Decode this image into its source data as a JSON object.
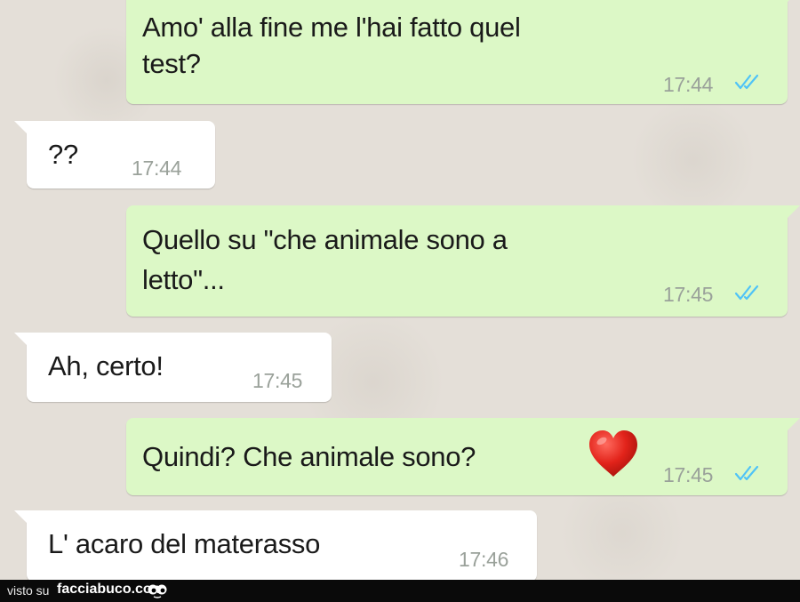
{
  "messages": [
    {
      "direction": "sent",
      "line1": "Amo' alla fine me l'hai fatto quel",
      "line2": "test?",
      "time": "17:44",
      "status": "double-tick-read"
    },
    {
      "direction": "received",
      "text": "??",
      "time": "17:44"
    },
    {
      "direction": "sent",
      "line1": "Quello su \"che animale sono a",
      "line2": "letto\"...",
      "time": "17:45",
      "status": "double-tick-read"
    },
    {
      "direction": "received",
      "text": "Ah, certo!",
      "time": "17:45"
    },
    {
      "direction": "sent",
      "text": "Quindi? Che animale sono?",
      "emoji": "red-heart",
      "time": "17:45",
      "status": "double-tick-read"
    },
    {
      "direction": "received",
      "text": "L' acaro del materasso",
      "time": "17:46"
    }
  ],
  "footer": {
    "prefix": "visto su",
    "site": "facciabuco.com",
    "logo": "eyes-icon"
  },
  "colors": {
    "sent_bubble": "#dcf8c6",
    "received_bubble": "#ffffff",
    "tick_blue": "#4fc3f7",
    "timestamp": "#9aa19a",
    "footer_bg": "#0a0a0a"
  }
}
